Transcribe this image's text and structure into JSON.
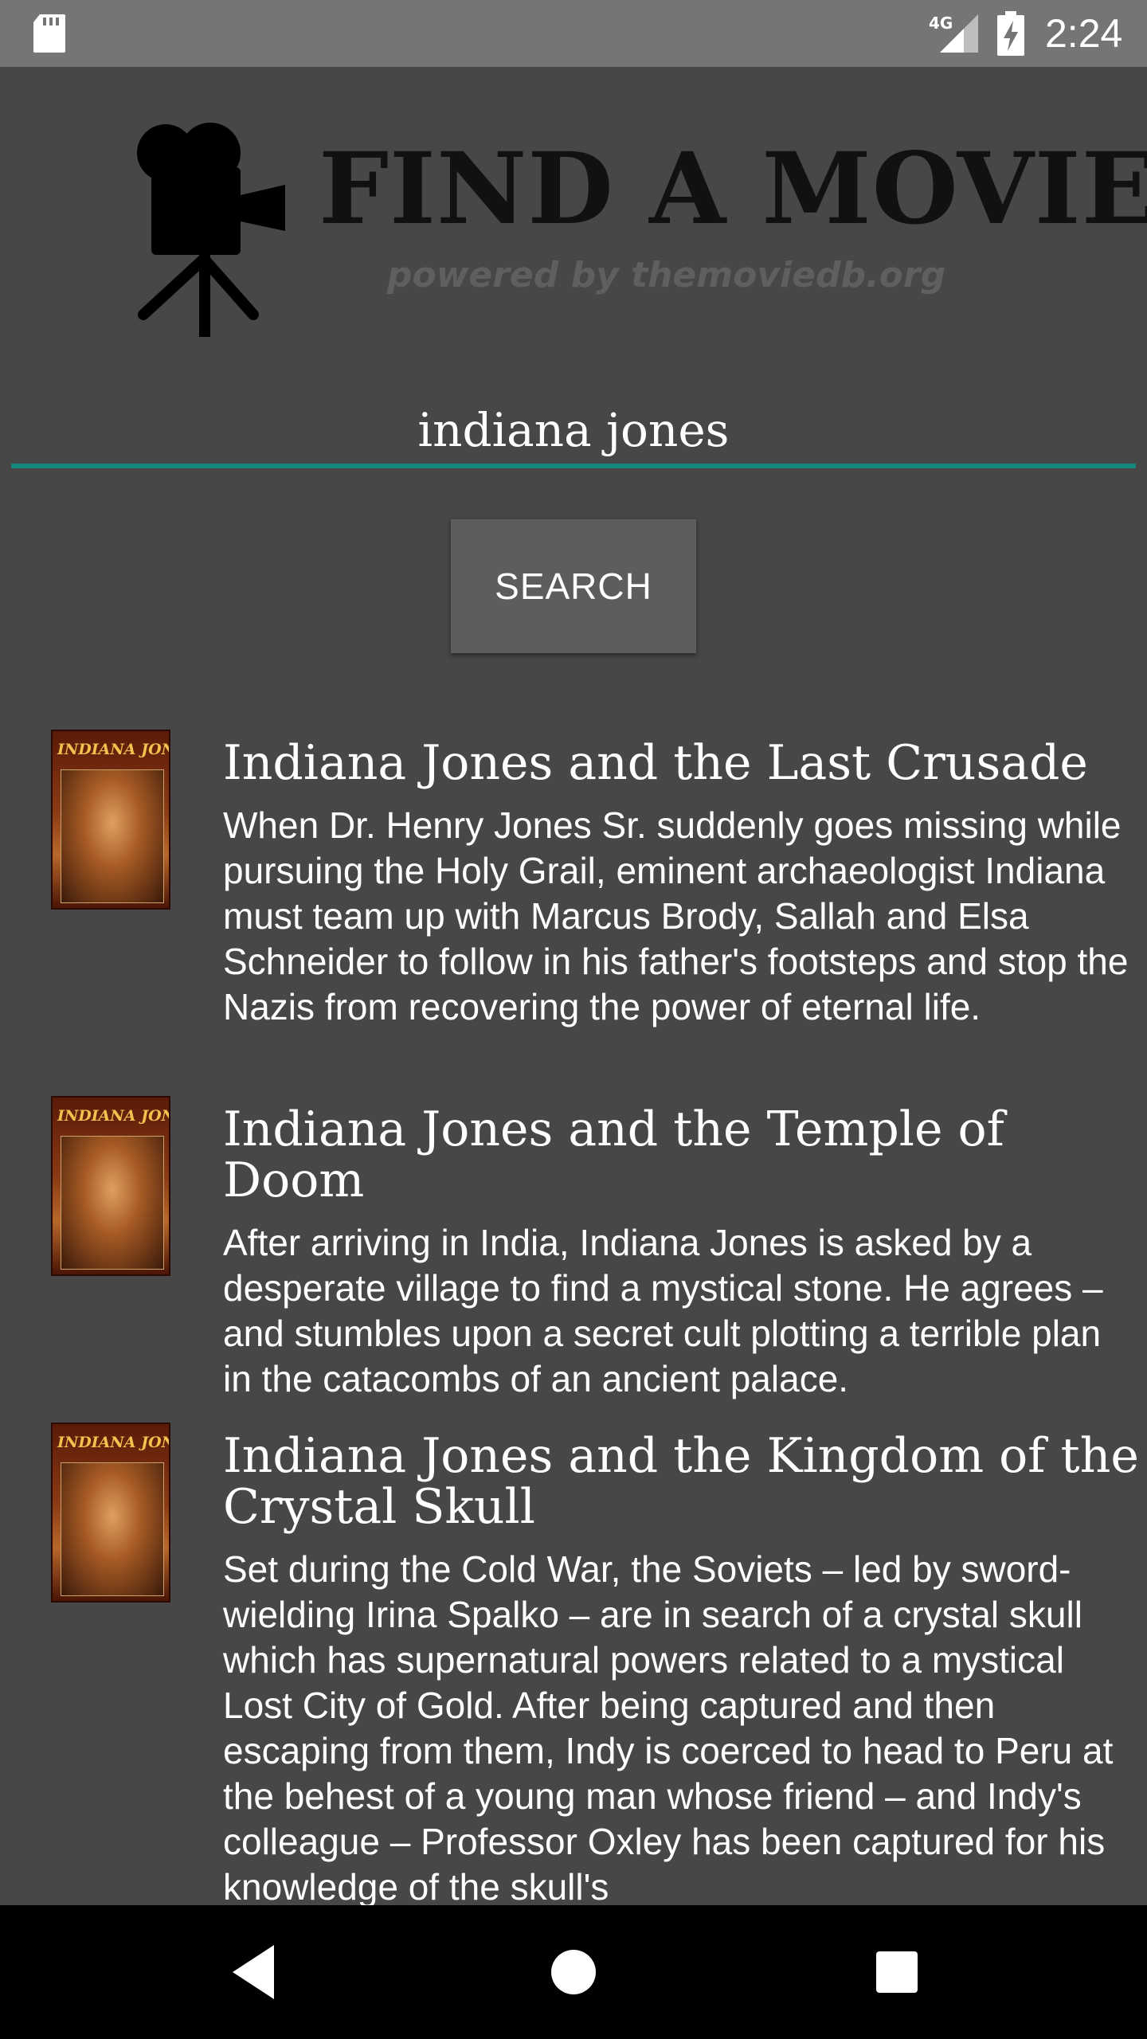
{
  "status_bar": {
    "time": "2:24",
    "network": "4G",
    "icons": [
      "sd-card-icon",
      "signal-4g-icon",
      "battery-charging-icon"
    ]
  },
  "logo": {
    "title": "FIND A MOVIE",
    "subtitle": "powered by themoviedb.org",
    "icon": "movie-camera-icon"
  },
  "search": {
    "value": "indiana jones",
    "button_label": "SEARCH",
    "accent_color": "#14897b"
  },
  "results": [
    {
      "poster_text": "INDIANA JONES",
      "title": "Indiana Jones and the Last Crusade",
      "overview": "When Dr. Henry Jones Sr. suddenly goes missing while pursuing the Holy Grail, eminent archaeologist Indiana must team up with Marcus Brody, Sallah and Elsa Schneider to follow in his father's footsteps and stop the Nazis from recovering the power of eternal life."
    },
    {
      "poster_text": "INDIANA JONES",
      "title": "Indiana Jones and the Temple of Doom",
      "overview": "After arriving in India, Indiana Jones is asked by a desperate village to find a mystical stone. He agrees – and stumbles upon a secret cult plotting a terrible plan in the catacombs of an ancient palace."
    },
    {
      "poster_text": "INDIANA JONES",
      "title": "Indiana Jones and the Kingdom of the Crystal Skull",
      "overview": "Set during the Cold War, the Soviets – led by sword-wielding Irina Spalko – are in search of a crystal skull which has supernatural powers related to a mystical Lost City of Gold. After being captured and then escaping from them, Indy is coerced to head to Peru at the behest of a young man whose friend – and Indy's colleague – Professor Oxley has been captured for his knowledge of the skull's"
    }
  ],
  "nav_bar": {
    "icons": [
      "back-icon",
      "home-icon",
      "recents-icon"
    ]
  }
}
